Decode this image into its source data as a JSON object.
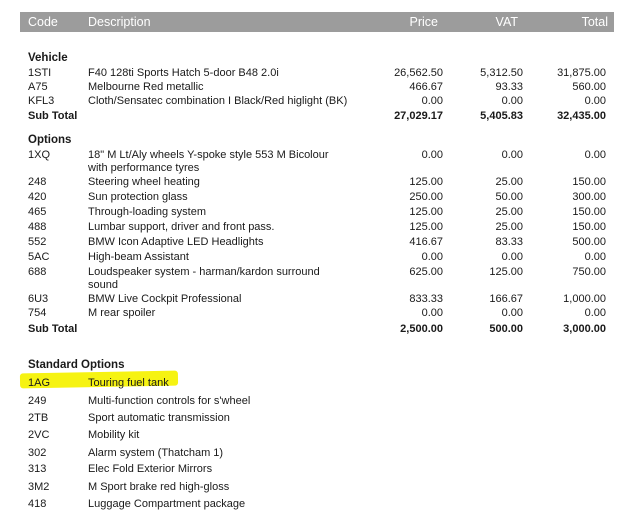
{
  "header": {
    "code": "Code",
    "description": "Description",
    "price": "Price",
    "vat": "VAT",
    "total": "Total"
  },
  "vehicle": {
    "title": "Vehicle",
    "items": [
      {
        "code": "1STI",
        "description": "F40 128ti Sports Hatch 5-door B48 2.0i",
        "price": "26,562.50",
        "vat": "5,312.50",
        "total": "31,875.00"
      },
      {
        "code": "A75",
        "description": "Melbourne Red metallic",
        "price": "466.67",
        "vat": "93.33",
        "total": "560.00"
      },
      {
        "code": "KFL3",
        "description": "Cloth/Sensatec combination I Black/Red higlight (BK)",
        "price": "0.00",
        "vat": "0.00",
        "total": "0.00"
      }
    ],
    "subtotal": {
      "label": "Sub Total",
      "price": "27,029.17",
      "vat": "5,405.83",
      "total": "32,435.00"
    }
  },
  "options": {
    "title": "Options",
    "items": [
      {
        "code": "1XQ",
        "description": "18\" M Lt/Aly wheels Y-spoke style 553 M Bicolour",
        "description2": "with performance tyres",
        "price": "0.00",
        "vat": "0.00",
        "total": "0.00"
      },
      {
        "code": "248",
        "description": "Steering wheel heating",
        "price": "125.00",
        "vat": "25.00",
        "total": "150.00"
      },
      {
        "code": "420",
        "description": "Sun protection glass",
        "price": "250.00",
        "vat": "50.00",
        "total": "300.00"
      },
      {
        "code": "465",
        "description": "Through-loading system",
        "price": "125.00",
        "vat": "25.00",
        "total": "150.00"
      },
      {
        "code": "488",
        "description": "Lumbar support, driver and front pass.",
        "price": "125.00",
        "vat": "25.00",
        "total": "150.00"
      },
      {
        "code": "552",
        "description": "BMW Icon Adaptive LED Headlights",
        "price": "416.67",
        "vat": "83.33",
        "total": "500.00"
      },
      {
        "code": "5AC",
        "description": "High-beam Assistant",
        "price": "0.00",
        "vat": "0.00",
        "total": "0.00"
      },
      {
        "code": "688",
        "description": "Loudspeaker system - harman/kardon surround",
        "description2": "sound",
        "price": "625.00",
        "vat": "125.00",
        "total": "750.00"
      },
      {
        "code": "6U3",
        "description": "BMW Live Cockpit Professional",
        "price": "833.33",
        "vat": "166.67",
        "total": "1,000.00"
      },
      {
        "code": "754",
        "description": "M rear spoiler",
        "price": "0.00",
        "vat": "0.00",
        "total": "0.00"
      }
    ],
    "subtotal": {
      "label": "Sub Total",
      "price": "2,500.00",
      "vat": "500.00",
      "total": "3,000.00"
    }
  },
  "standard_options": {
    "title": "Standard Options",
    "items": [
      {
        "code": "1AG",
        "description": "Touring fuel tank"
      },
      {
        "code": "249",
        "description": "Multi-function controls for s'wheel"
      },
      {
        "code": "2TB",
        "description": "Sport automatic transmission"
      },
      {
        "code": "2VC",
        "description": "Mobility kit"
      },
      {
        "code": "302",
        "description": "Alarm system (Thatcham 1)"
      },
      {
        "code": "313",
        "description": "Elec Fold Exterior Mirrors"
      },
      {
        "code": "3M2",
        "description": "M Sport brake red high-gloss"
      },
      {
        "code": "418",
        "description": "Luggage Compartment package"
      }
    ]
  },
  "colors": {
    "header_bg": "#9c9c9c",
    "highlight": "#f6f312"
  }
}
